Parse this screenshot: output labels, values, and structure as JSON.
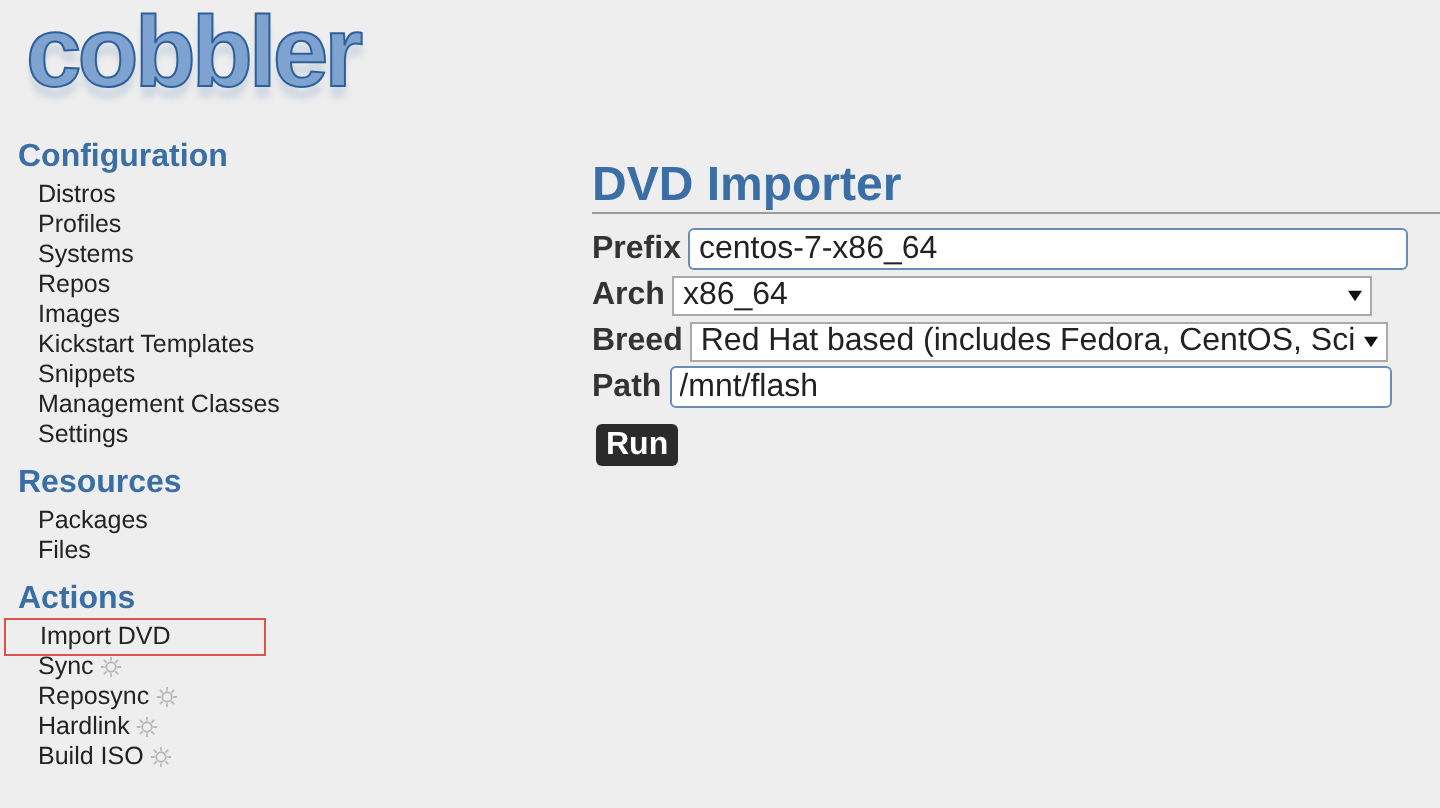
{
  "logo": {
    "text": "cobbler"
  },
  "sidebar": {
    "sections": [
      {
        "title": "Configuration",
        "items": [
          {
            "label": "Distros",
            "kind": "link",
            "selected": false
          },
          {
            "label": "Profiles",
            "kind": "link",
            "selected": false
          },
          {
            "label": "Systems",
            "kind": "link",
            "selected": false
          },
          {
            "label": "Repos",
            "kind": "link",
            "selected": false
          },
          {
            "label": "Images",
            "kind": "link",
            "selected": false
          },
          {
            "label": "Kickstart Templates",
            "kind": "link",
            "selected": false
          },
          {
            "label": "Snippets",
            "kind": "link",
            "selected": false
          },
          {
            "label": "Management Classes",
            "kind": "link",
            "selected": false
          },
          {
            "label": "Settings",
            "kind": "link",
            "selected": false
          }
        ]
      },
      {
        "title": "Resources",
        "items": [
          {
            "label": "Packages",
            "kind": "link",
            "selected": false
          },
          {
            "label": "Files",
            "kind": "link",
            "selected": false
          }
        ]
      },
      {
        "title": "Actions",
        "items": [
          {
            "label": "Import DVD",
            "kind": "link",
            "selected": true
          },
          {
            "label": "Sync",
            "kind": "task",
            "selected": false
          },
          {
            "label": "Reposync",
            "kind": "task",
            "selected": false
          },
          {
            "label": "Hardlink",
            "kind": "task",
            "selected": false
          },
          {
            "label": "Build ISO",
            "kind": "task",
            "selected": false
          }
        ]
      }
    ]
  },
  "main": {
    "title": "DVD Importer",
    "fields": [
      {
        "label": "Prefix",
        "kind": "input",
        "value": "centos-7-x86_64"
      },
      {
        "label": "Arch",
        "kind": "select",
        "value": "x86_64"
      },
      {
        "label": "Breed",
        "kind": "select",
        "value": "Red Hat based (includes Fedora, CentOS, Sci"
      },
      {
        "label": "Path",
        "kind": "input",
        "value": "/mnt/flash"
      }
    ],
    "button": "Run"
  }
}
